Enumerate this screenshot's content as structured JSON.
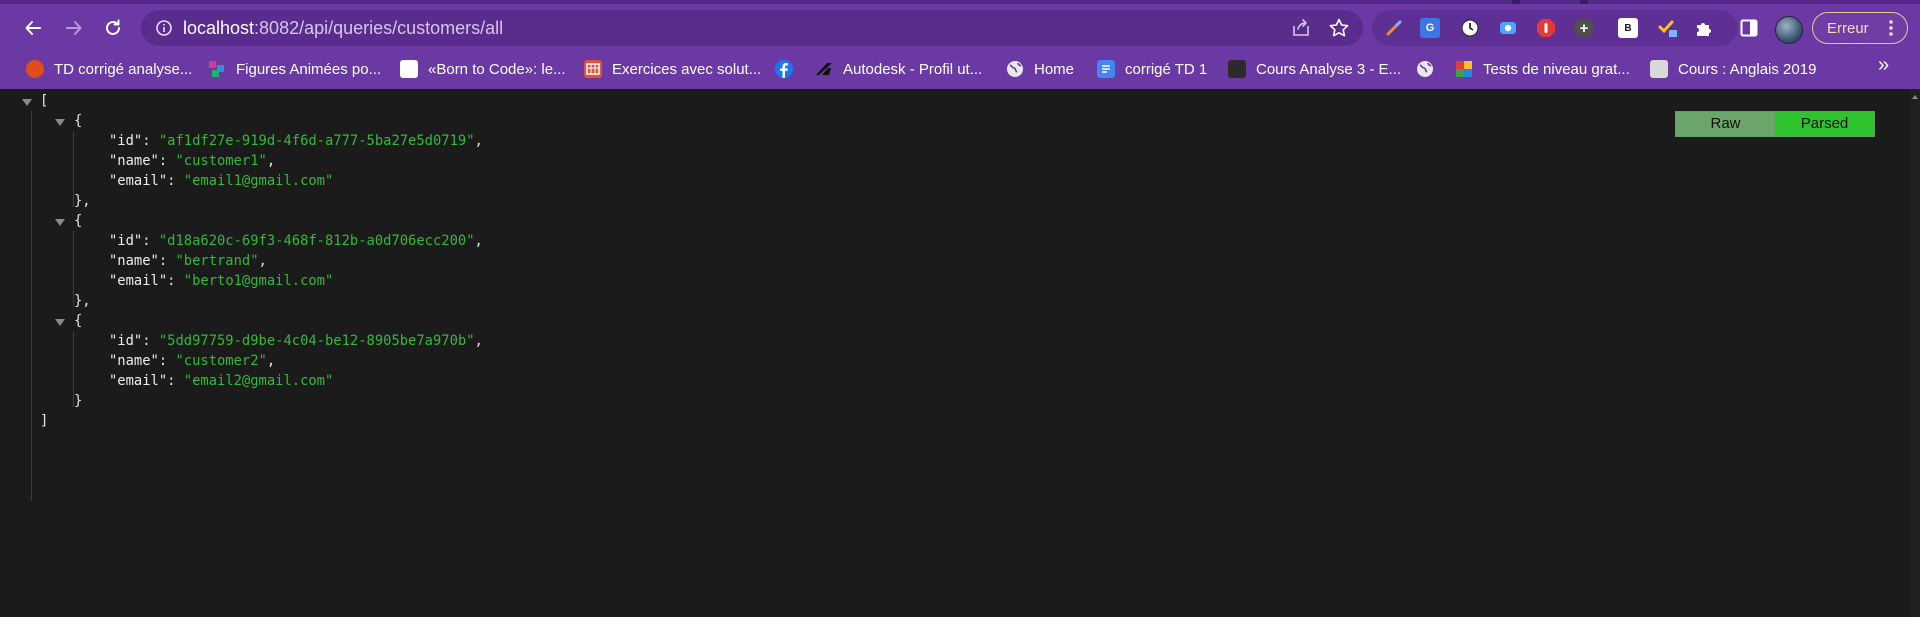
{
  "browser": {
    "url_host": "localhost",
    "url_path": ":8082/api/queries/customers/all",
    "profile_button": "Erreur",
    "extensions": [
      {
        "name": "color-picker-icon",
        "text": "",
        "color": "#f28c3a"
      },
      {
        "name": "google-translate-icon",
        "text": "G",
        "color": "#3b78e7"
      },
      {
        "name": "clock-icon",
        "text": "",
        "color": "#ffffff"
      },
      {
        "name": "screen-capture-icon",
        "text": "",
        "color": "#4aa3ff"
      },
      {
        "name": "stop-hand-icon",
        "text": "",
        "color": "#e53935"
      },
      {
        "name": "add-extension-icon",
        "text": "+",
        "color": "#4f4f4f"
      },
      {
        "name": "b-extension-icon",
        "text": "B",
        "color": "#ffffff"
      },
      {
        "name": "check-edit-icon",
        "text": "",
        "color": "#f5c518"
      },
      {
        "name": "puzzle-icon",
        "text": "",
        "color": "#ffffff"
      }
    ]
  },
  "bookmarks": [
    {
      "name": "bookmark-td-corrige",
      "label": "TD corrigé analyse...",
      "color": "#e24b1b"
    },
    {
      "name": "bookmark-figures-animees",
      "label": "Figures Animées po...",
      "color": "#d23b8a"
    },
    {
      "name": "bookmark-born-to-code",
      "label": "«Born to Code»: le...",
      "color": "#ffffff"
    },
    {
      "name": "bookmark-exercices",
      "label": "Exercices avec solut...",
      "color": "#e0523f"
    },
    {
      "name": "bookmark-facebook",
      "label": "",
      "color": "#1877f2"
    },
    {
      "name": "bookmark-autodesk",
      "label": "Autodesk - Profil ut...",
      "color": "#111111"
    },
    {
      "name": "bookmark-home",
      "label": "Home",
      "color": "#e9e9e9"
    },
    {
      "name": "bookmark-corrige-td1",
      "label": "corrigé TD 1",
      "color": "#4285f4"
    },
    {
      "name": "bookmark-cours-analyse",
      "label": "Cours Analyse 3 - E...",
      "color": "#2b2b2b"
    },
    {
      "name": "bookmark-globe",
      "label": "",
      "color": "#e9e9e9"
    },
    {
      "name": "bookmark-tests-niveau",
      "label": "Tests de niveau grat...",
      "color": "#e53935"
    },
    {
      "name": "bookmark-cours-anglais",
      "label": "Cours : Anglais 2019",
      "color": "#d8d8d8"
    }
  ],
  "json_viewer": {
    "toggle_raw": "Raw",
    "toggle_parsed": "Parsed",
    "open_bracket": "[",
    "close_bracket": "]",
    "open_brace": "{",
    "close_brace_comma": "},",
    "close_brace": "}",
    "key_id": "\"id\"",
    "key_name": "\"name\"",
    "key_email": "\"email\"",
    "customers": [
      {
        "id": "\"af1df27e-919d-4f6d-a777-5ba27e5d0719\"",
        "name": "\"customer1\"",
        "email": "\"email1@gmail.com\""
      },
      {
        "id": "\"d18a620c-69f3-468f-812b-a0d706ecc200\"",
        "name": "\"bertrand\"",
        "email": "\"berto1@gmail.com\""
      },
      {
        "id": "\"5dd97759-d9be-4c04-be12-8905be7a970b\"",
        "name": "\"customer2\"",
        "email": "\"email2@gmail.com\""
      }
    ]
  }
}
